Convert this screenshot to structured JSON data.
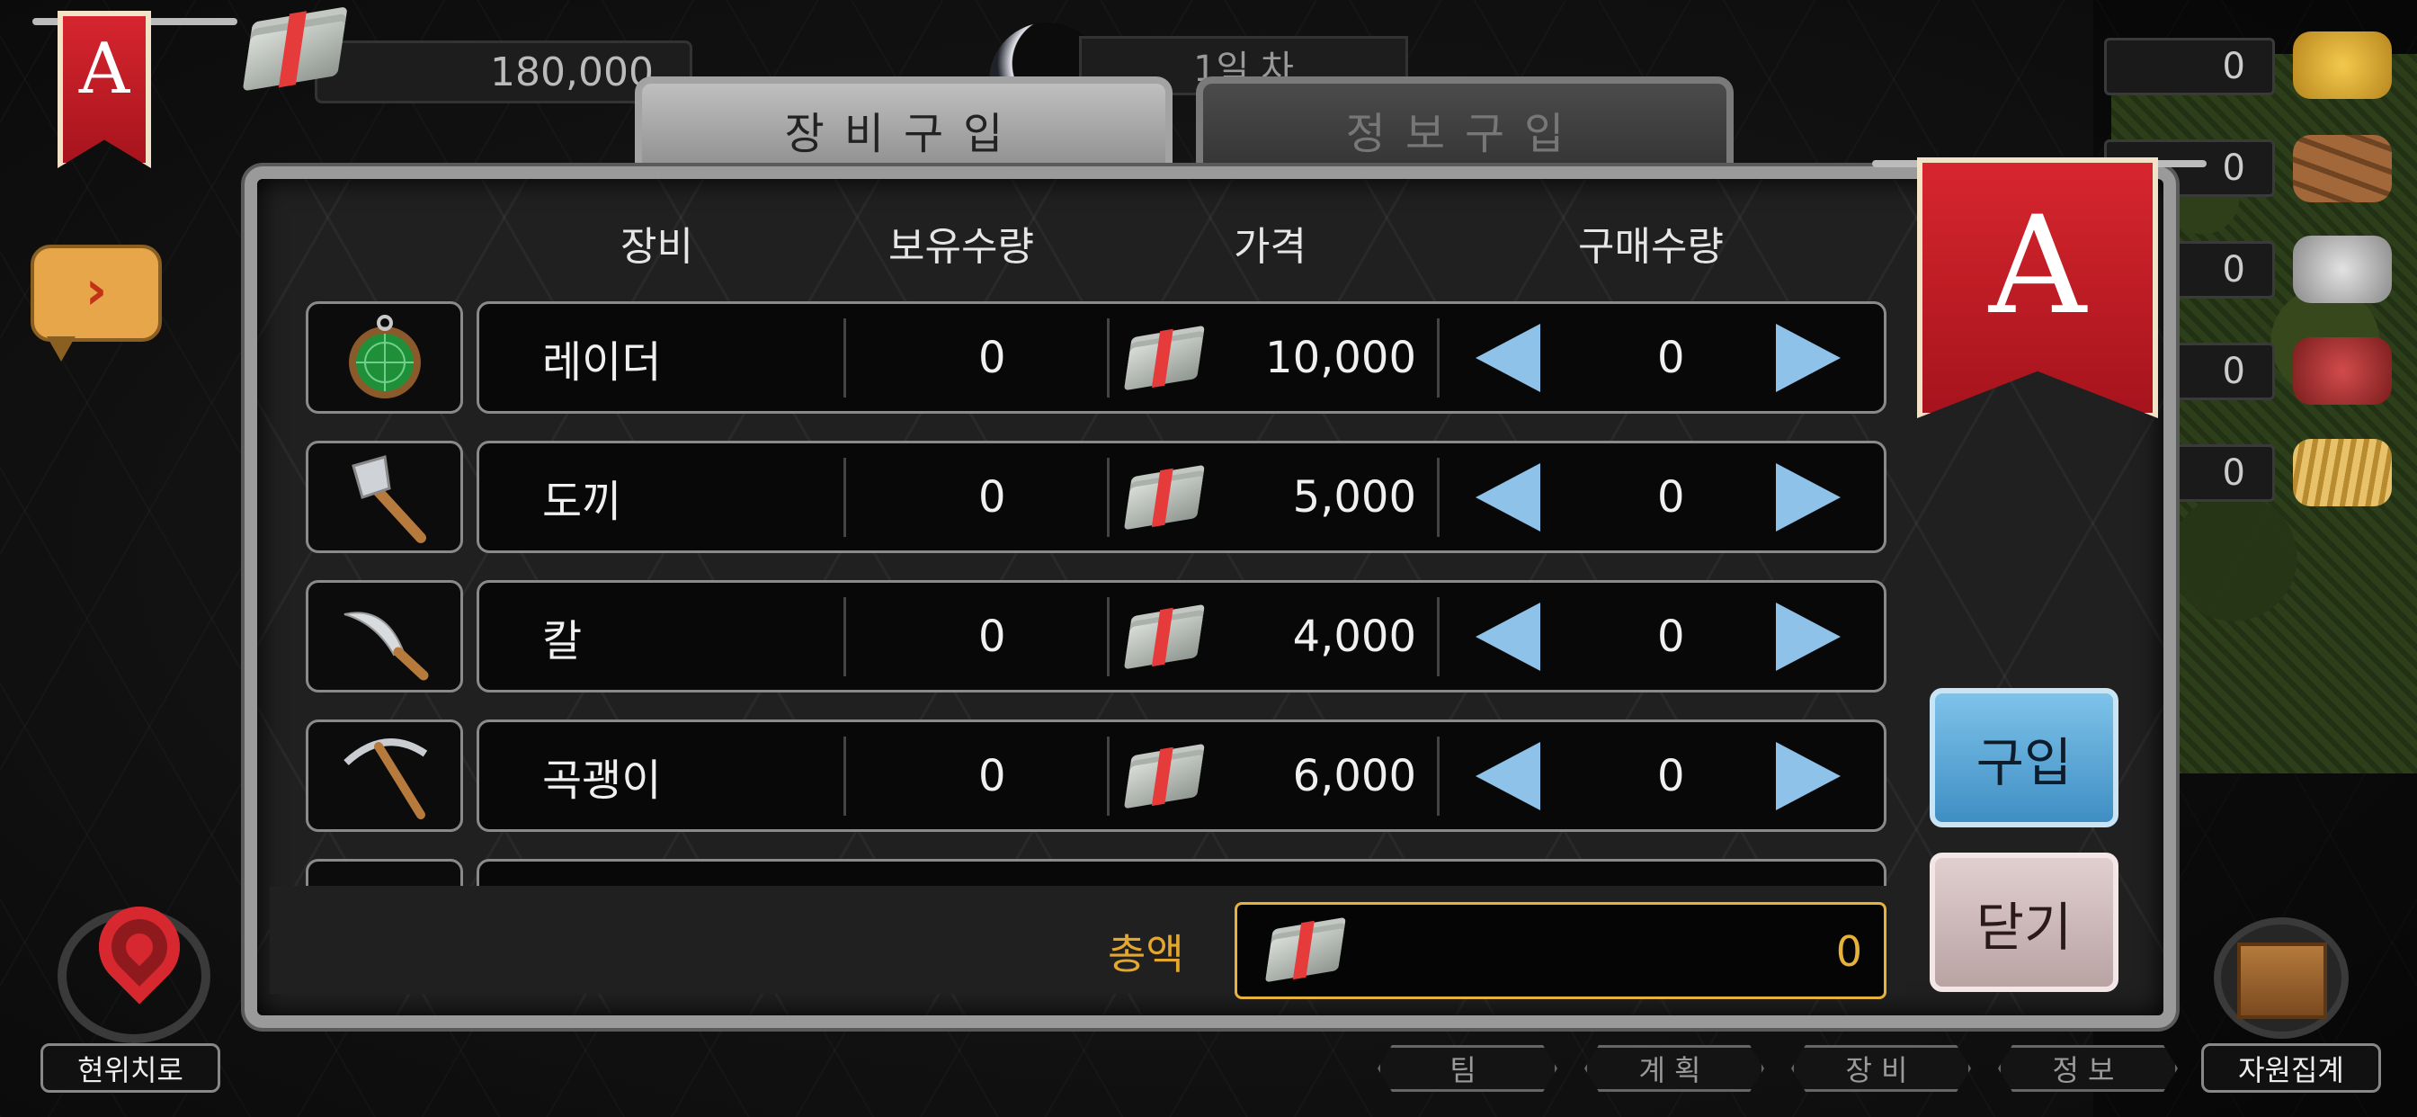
{
  "top": {
    "money": "180,000",
    "day": "1일 차",
    "banner_letter": "A"
  },
  "resources": [
    "0",
    "0",
    "0",
    "0",
    "0"
  ],
  "resource_icons": [
    "gold-pile-icon",
    "logs-icon",
    "stone-icon",
    "meat-icon",
    "hay-icon"
  ],
  "tabs": {
    "equipment": "장비구입",
    "info": "정보구입"
  },
  "columns": {
    "item": "장비",
    "owned": "보유수량",
    "price": "가격",
    "buy_qty": "구매수량"
  },
  "items": [
    {
      "name": "레이더",
      "owned": "0",
      "price": "10,000",
      "qty": "0",
      "icon": "radar-icon"
    },
    {
      "name": "도끼",
      "owned": "0",
      "price": "5,000",
      "qty": "0",
      "icon": "axe-icon"
    },
    {
      "name": "칼",
      "owned": "0",
      "price": "4,000",
      "qty": "0",
      "icon": "knife-icon"
    },
    {
      "name": "곡괭이",
      "owned": "0",
      "price": "6,000",
      "qty": "0",
      "icon": "pickaxe-icon"
    }
  ],
  "panel": {
    "banner_letter": "A",
    "buy_label": "구입",
    "close_label": "닫기",
    "total_label": "총액",
    "total_value": "0"
  },
  "bottom": {
    "location_label": "현위치로",
    "nav": [
      "팀",
      "계획",
      "장비",
      "정보"
    ],
    "resource_summary": "자원집계"
  },
  "colors": {
    "banner_red": "#d8262f",
    "arrow_blue": "#8fc2e8",
    "gold": "#e6b23a",
    "buy_button": "#5aa8d8",
    "close_button": "#d0bcbc"
  }
}
